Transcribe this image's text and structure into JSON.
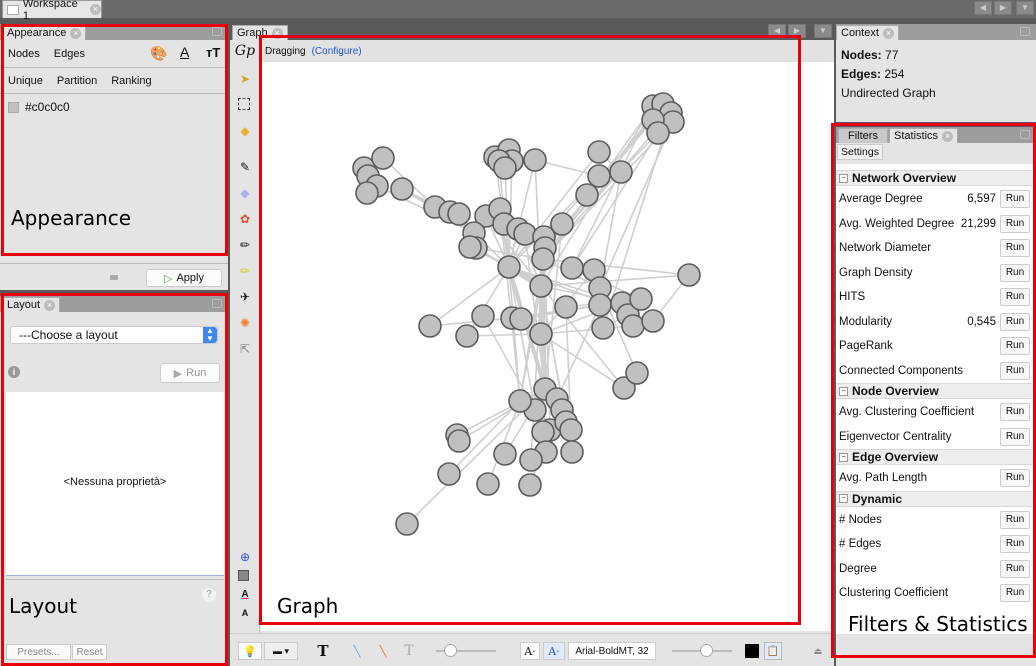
{
  "workspace": {
    "tab_label": "Workspace 1"
  },
  "appearance": {
    "tab_label": "Appearance",
    "element_tabs": [
      "Nodes",
      "Edges"
    ],
    "mode_tabs": [
      "Unique",
      "Partition",
      "Ranking"
    ],
    "color_value": "#c0c0c0",
    "apply_label": "Apply",
    "annotation": "Appearance"
  },
  "layout": {
    "tab_label": "Layout",
    "select_value": "---Choose a layout",
    "run_label": "Run",
    "properties_text": "<Nessuna proprietà>",
    "presets_label": "Presets...",
    "reset_label": "Reset",
    "annotation": "Layout"
  },
  "graph": {
    "tab_label": "Graph",
    "mode_text": "Dragging",
    "configure_link": "(Configure)",
    "font_value": "Arial-BoldMT, 32",
    "annotation": "Graph",
    "node_color": "#c0c0c0",
    "edge_color": "#cfcfcf"
  },
  "context": {
    "tab_label": "Context",
    "nodes_label": "Nodes:",
    "nodes_value": "77",
    "edges_label": "Edges:",
    "edges_value": "254",
    "graph_type": "Undirected Graph"
  },
  "statistics": {
    "tabs": [
      "Filters",
      "Statistics"
    ],
    "settings_label": "Settings",
    "run_label": "Run",
    "annotation": "Filters & Statistics",
    "sections": [
      {
        "title": "Network Overview",
        "rows": [
          {
            "label": "Average Degree",
            "value": "6,597"
          },
          {
            "label": "Avg. Weighted Degree",
            "value": "21,299"
          },
          {
            "label": "Network Diameter",
            "value": ""
          },
          {
            "label": "Graph Density",
            "value": ""
          },
          {
            "label": "HITS",
            "value": ""
          },
          {
            "label": "Modularity",
            "value": "0,545"
          },
          {
            "label": "PageRank",
            "value": ""
          },
          {
            "label": "Connected Components",
            "value": ""
          }
        ]
      },
      {
        "title": "Node Overview",
        "rows": [
          {
            "label": "Avg. Clustering Coefficient",
            "value": ""
          },
          {
            "label": "Eigenvector Centrality",
            "value": ""
          }
        ]
      },
      {
        "title": "Edge Overview",
        "rows": [
          {
            "label": "Avg. Path Length",
            "value": ""
          }
        ]
      },
      {
        "title": "Dynamic",
        "rows": [
          {
            "label": "# Nodes",
            "value": ""
          },
          {
            "label": "# Edges",
            "value": ""
          },
          {
            "label": "Degree",
            "value": ""
          },
          {
            "label": "Clustering Coefficient",
            "value": ""
          }
        ]
      }
    ]
  }
}
